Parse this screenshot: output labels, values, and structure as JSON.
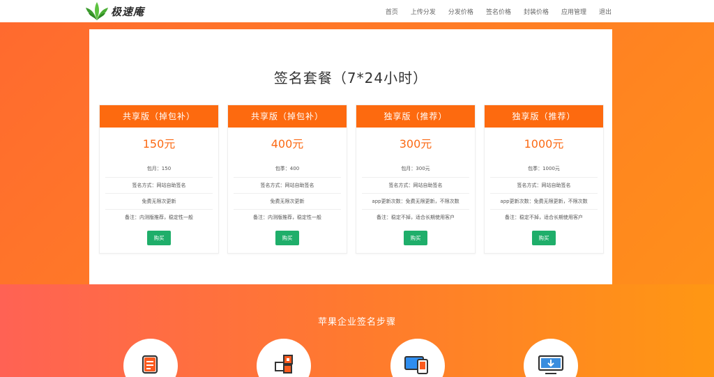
{
  "brand": {
    "name": "极速庵",
    "logo_icon": "leaf-logo-icon"
  },
  "nav": {
    "items": [
      {
        "label": "首页"
      },
      {
        "label": "上传分发"
      },
      {
        "label": "分发价格"
      },
      {
        "label": "签名价格"
      },
      {
        "label": "封装价格"
      },
      {
        "label": "应用管理"
      },
      {
        "label": "退出"
      }
    ]
  },
  "main": {
    "title": "签名套餐（7*24小时）",
    "plans": [
      {
        "name": "共享版（掉包补）",
        "price": "150元",
        "rows": [
          "包月：150",
          "签名方式：网站自助签名",
          "免费无限次更新",
          "备注：内测版推荐，稳定性一般"
        ],
        "buy_label": "购买"
      },
      {
        "name": "共享版（掉包补）",
        "price": "400元",
        "rows": [
          "包季：400",
          "签名方式：网站自助签名",
          "免费无限次更新",
          "备注：内测版推荐，稳定性一般"
        ],
        "buy_label": "购买"
      },
      {
        "name": "独享版（推荐）",
        "price": "300元",
        "rows": [
          "包月：300元",
          "签名方式：网站自助签名",
          "app更新次数：免费无限更新，不限次数",
          "备注：稳定不掉，适合长期使用客户"
        ],
        "buy_label": "购买"
      },
      {
        "name": "独享版（推荐）",
        "price": "1000元",
        "rows": [
          "包季：1000元",
          "签名方式：网站自助签名",
          "app更新次数：免费无限更新，不限次数",
          "备注：稳定不掉，适合长期使用客户"
        ],
        "buy_label": "购买"
      }
    ]
  },
  "steps": {
    "title": "苹果企业签名步骤",
    "icons": [
      "document-edit-icon",
      "grid-blocks-icon",
      "devices-icon",
      "monitor-download-icon"
    ]
  },
  "colors": {
    "accent": "#fd6a0f",
    "buy": "#1fae6a",
    "icon_orange": "#fb5a1e"
  }
}
